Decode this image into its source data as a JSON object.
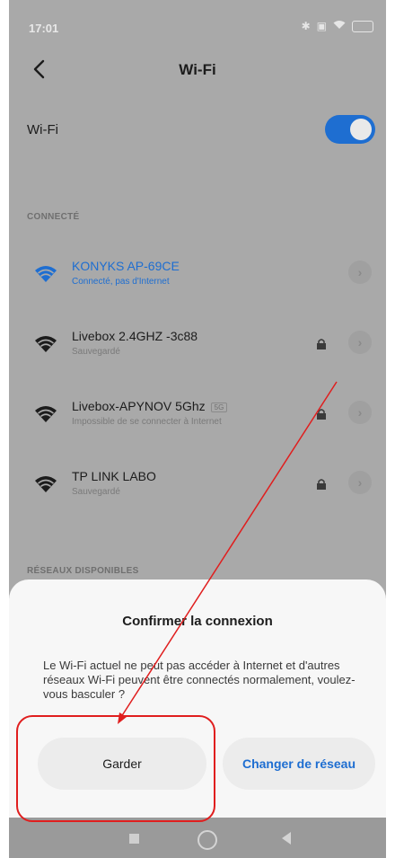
{
  "status_bar": {
    "time": "17:01",
    "battery": "88"
  },
  "header": {
    "title": "Wi-Fi",
    "back_icon": "arrow-left-icon"
  },
  "wifi_toggle": {
    "label": "Wi-Fi",
    "state": "on"
  },
  "sections": {
    "connected_header": "CONNECTÉ",
    "available_header": "RÉSEAUX DISPONIBLES"
  },
  "networks": [
    {
      "name": "KONYKS AP-69CE",
      "status": "Connecté, pas d'Internet",
      "connected": true,
      "locked": false
    },
    {
      "name": "Livebox 2.4GHZ -3c88",
      "status": "Sauvegardé",
      "connected": false,
      "locked": true
    },
    {
      "name": "Livebox-APYNOV 5Ghz",
      "badge": "5G",
      "status": "Impossible de se connecter à Internet",
      "connected": false,
      "locked": true
    },
    {
      "name": "TP LINK LABO",
      "status": "Sauvegardé",
      "connected": false,
      "locked": true
    }
  ],
  "dialog": {
    "title": "Confirmer la connexion",
    "message": "Le Wi-Fi actuel ne peut pas accéder à Internet et d'autres réseaux Wi-Fi peuvent être connectés normalement, voulez-vous basculer ?",
    "keep_label": "Garder",
    "change_label": "Changer de réseau"
  },
  "colors": {
    "accent": "#1e6ed1",
    "annotation": "#e01e1e",
    "scrim": "#a9a9a9"
  }
}
